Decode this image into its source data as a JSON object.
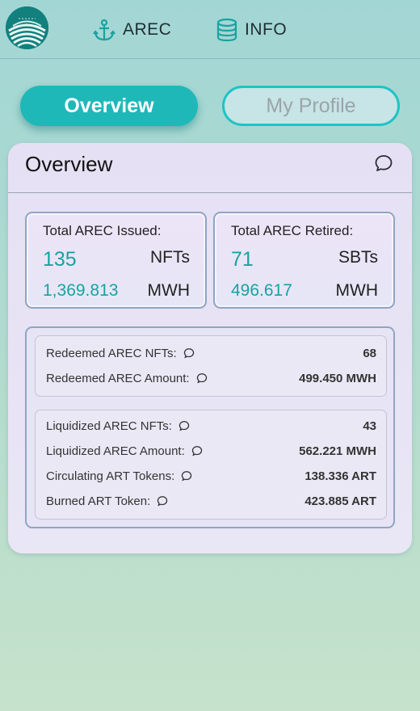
{
  "nav": {
    "logo_icon": "arec-logo",
    "items": [
      {
        "label": "AREC",
        "icon": "anchor-icon"
      },
      {
        "label": "INFO",
        "icon": "database-icon"
      }
    ]
  },
  "tabs": {
    "overview": "Overview",
    "profile": "My Profile"
  },
  "overview": {
    "title": "Overview",
    "issued": {
      "label": "Total AREC Issued:",
      "count": "135",
      "count_unit": "NFTs",
      "amount": "1,369.813",
      "amount_unit": "MWH"
    },
    "retired": {
      "label": "Total AREC Retired:",
      "count": "71",
      "count_unit": "SBTs",
      "amount": "496.617",
      "amount_unit": "MWH"
    },
    "redeemed": [
      {
        "label": "Redeemed AREC NFTs:",
        "value": "68"
      },
      {
        "label": "Redeemed AREC Amount:",
        "value": "499.450 MWH"
      }
    ],
    "liquidized": [
      {
        "label": "Liquidized AREC NFTs:",
        "value": "43"
      },
      {
        "label": "Liquidized AREC Amount:",
        "value": "562.221 MWH"
      },
      {
        "label": "Circulating ART Tokens:",
        "value": "138.336 ART"
      },
      {
        "label": "Burned ART Token:",
        "value": "423.885 ART"
      }
    ]
  },
  "colors": {
    "accent": "#1fb8b9",
    "value_teal": "#18a3a0",
    "background_top": "#a2d6d5",
    "background_bottom": "#c6e2cc",
    "card": "#e7e3f5"
  }
}
